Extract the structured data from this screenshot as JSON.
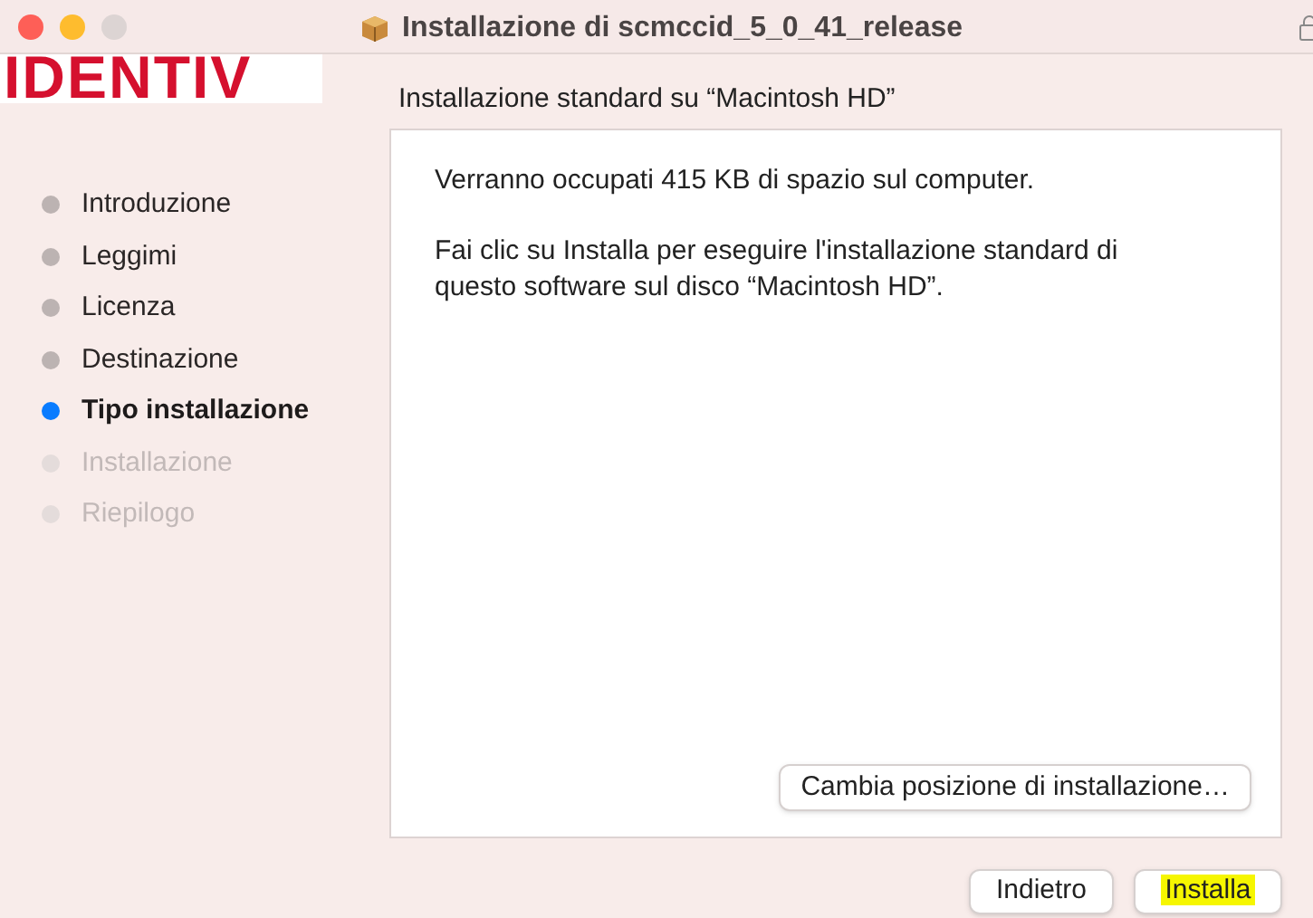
{
  "window": {
    "title": "Installazione di scmccid_5_0_41_release"
  },
  "logo": "IDENTIV",
  "steps": [
    {
      "label": "Introduzione",
      "kind": "done"
    },
    {
      "label": "Leggimi",
      "kind": "done"
    },
    {
      "label": "Licenza",
      "kind": "done"
    },
    {
      "label": "Destinazione",
      "kind": "done"
    },
    {
      "label": "Tipo installazione",
      "kind": "current"
    },
    {
      "label": "Installazione",
      "kind": "pending"
    },
    {
      "label": "Riepilogo",
      "kind": "pending"
    }
  ],
  "heading": "Installazione standard su “Macintosh HD”",
  "paragraphs": [
    "Verranno occupati 415 KB di spazio sul computer.",
    "Fai clic su Installa per eseguire l'installazione standard di questo software sul disco “Macintosh HD”."
  ],
  "change_location_button": "Cambia posizione di installazione…",
  "buttons": [
    {
      "label": "Indietro",
      "highlighted": false
    },
    {
      "label": "Installa",
      "highlighted": true
    }
  ]
}
